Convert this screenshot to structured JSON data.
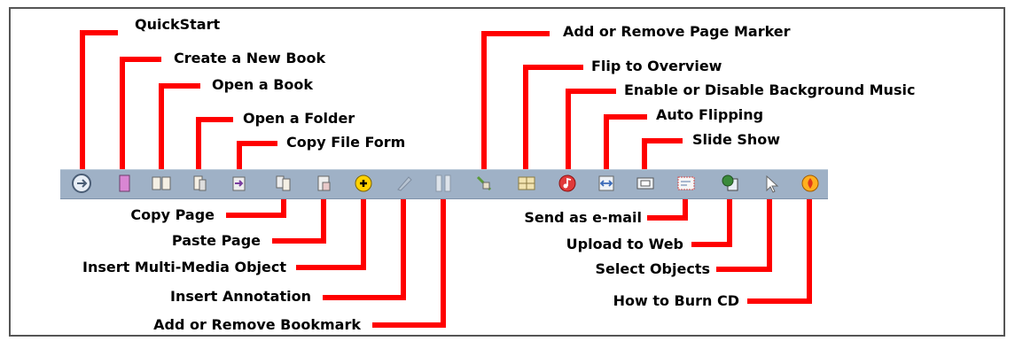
{
  "labels": {
    "quickstart": "QuickStart",
    "create_new_book": "Create a New Book",
    "open_book": "Open a Book",
    "open_folder": "Open a Folder",
    "copy_file_form": "Copy File Form",
    "page_marker": "Add or Remove Page Marker",
    "flip_overview": "Flip to Overview",
    "bg_music": "Enable or Disable Background Music",
    "auto_flipping": "Auto Flipping",
    "slide_show": "Slide Show",
    "copy_page": "Copy Page",
    "paste_page": "Paste Page",
    "insert_multimedia": "Insert Multi-Media Object",
    "insert_annotation": "Insert Annotation",
    "bookmark": "Add or Remove Bookmark",
    "send_email": "Send as e-mail",
    "upload_web": "Upload to Web",
    "select_objects": "Select Objects",
    "burn_cd": "How to Burn CD"
  },
  "colors": {
    "connector": "#ff0000",
    "toolbar": "#9fb1c6"
  }
}
